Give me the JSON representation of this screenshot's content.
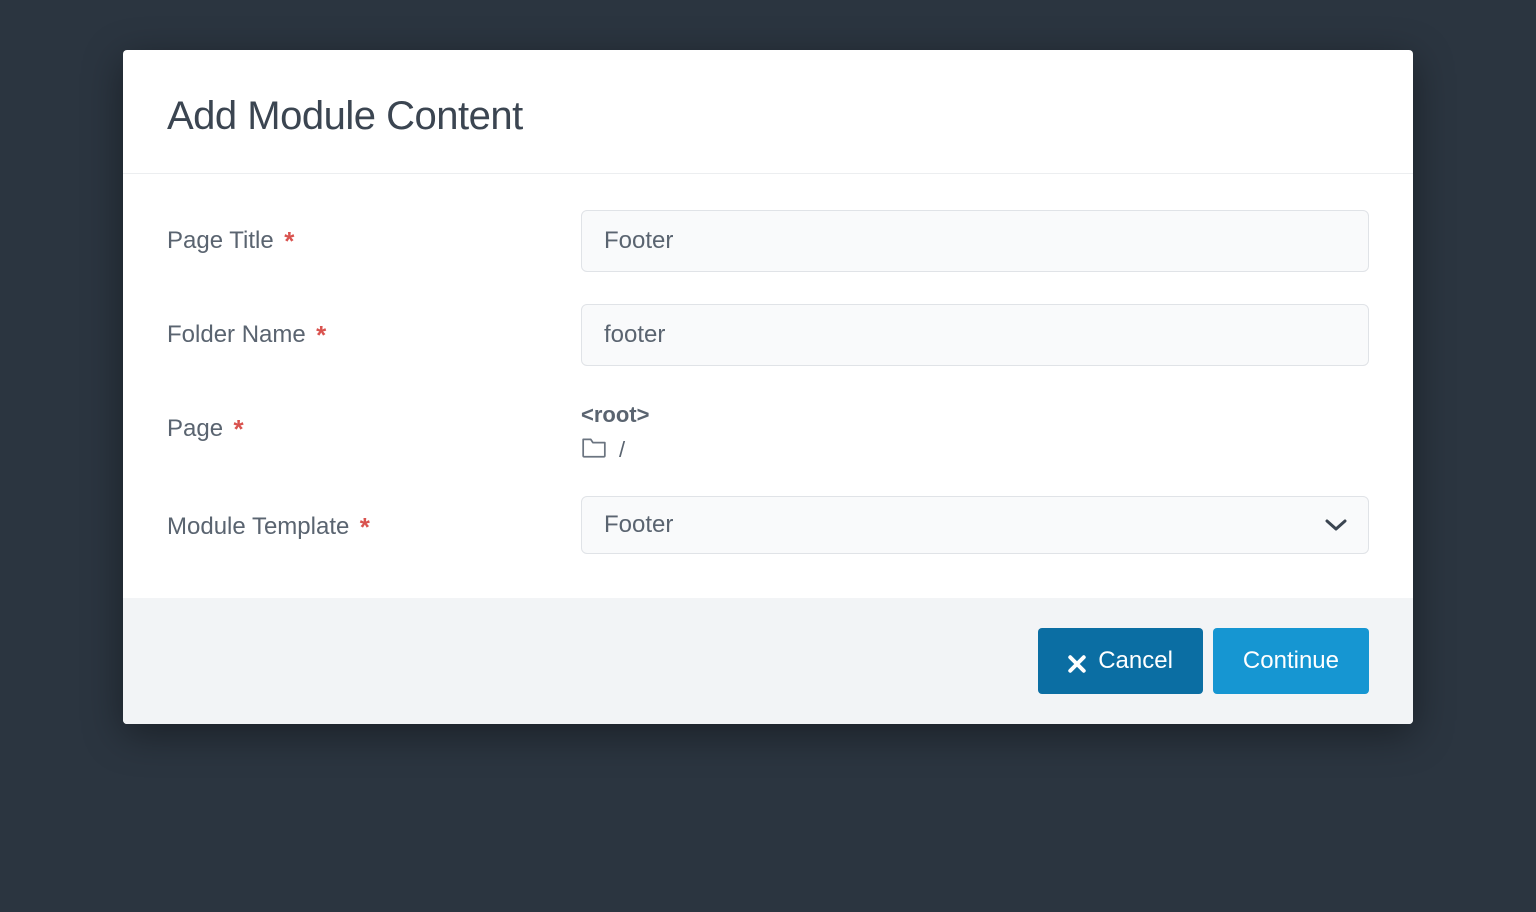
{
  "modal": {
    "title": "Add Module Content"
  },
  "form": {
    "page_title": {
      "label": "Page Title",
      "value": "Footer"
    },
    "folder_name": {
      "label": "Folder Name",
      "value": "footer"
    },
    "page": {
      "label": "Page",
      "root_label": "<root>",
      "path": "/"
    },
    "module_template": {
      "label": "Module Template",
      "selected": "Footer"
    }
  },
  "footer": {
    "cancel_label": "Cancel",
    "continue_label": "Continue"
  }
}
